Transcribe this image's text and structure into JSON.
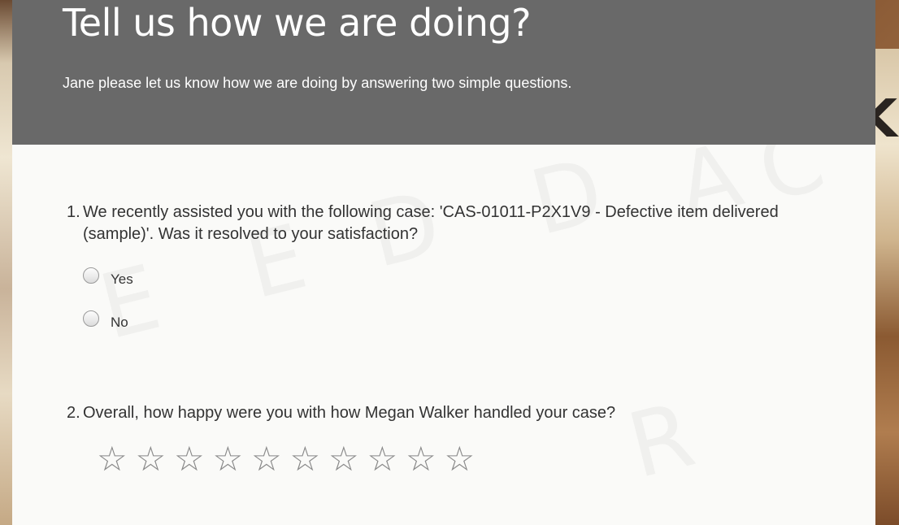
{
  "header": {
    "title": "Tell us how we are doing?",
    "subtitle": "Jane please let us know how we are doing by answering two simple questions."
  },
  "questions": [
    {
      "number": "1.",
      "text": "We recently assisted you with the following case: 'CAS-01011-P2X1V9 - Defective item delivered (sample)'. Was it resolved to your satisfaction?",
      "options": [
        "Yes",
        "No"
      ]
    },
    {
      "number": "2.",
      "text": "Overall, how happy were you with how Megan Walker handled your case?",
      "rating": {
        "max": 10,
        "value": 0,
        "star_glyph": "☆",
        "star_color": "#8a8a8a"
      }
    }
  ],
  "colors": {
    "header_bg": "#696969",
    "card_bg": "#fafaf8",
    "text": "#333333"
  }
}
